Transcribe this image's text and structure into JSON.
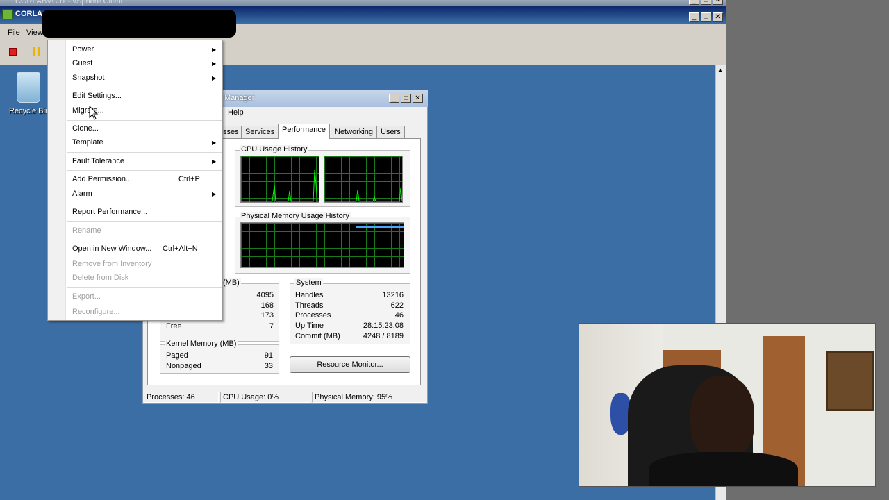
{
  "outer_window": {
    "title": "CORLABVC01 - vSphere Client"
  },
  "console_window": {
    "title": "CORLA",
    "menu": {
      "file": "File",
      "view": "View"
    }
  },
  "desktop": {
    "recycle_bin_label": "Recycle Bin"
  },
  "context_menu": {
    "items": [
      {
        "label": "Power",
        "shortcut": "",
        "submenu": true,
        "disabled": false
      },
      {
        "label": "Guest",
        "shortcut": "",
        "submenu": true,
        "disabled": false
      },
      {
        "label": "Snapshot",
        "shortcut": "",
        "submenu": true,
        "disabled": false
      },
      {
        "label": "Edit Settings...",
        "shortcut": "",
        "submenu": false,
        "disabled": false
      },
      {
        "label": "Migrate...",
        "shortcut": "",
        "submenu": false,
        "disabled": false
      },
      {
        "label": "Clone...",
        "shortcut": "",
        "submenu": false,
        "disabled": false
      },
      {
        "label": "Template",
        "shortcut": "",
        "submenu": true,
        "disabled": false
      },
      {
        "label": "Fault Tolerance",
        "shortcut": "",
        "submenu": true,
        "disabled": false
      },
      {
        "label": "Add Permission...",
        "shortcut": "Ctrl+P",
        "submenu": false,
        "disabled": false
      },
      {
        "label": "Alarm",
        "shortcut": "",
        "submenu": true,
        "disabled": false
      },
      {
        "label": "Report Performance...",
        "shortcut": "",
        "submenu": false,
        "disabled": false
      },
      {
        "label": "Rename",
        "shortcut": "",
        "submenu": false,
        "disabled": true
      },
      {
        "label": "Open in New Window...",
        "shortcut": "Ctrl+Alt+N",
        "submenu": false,
        "disabled": false
      },
      {
        "label": "Remove from Inventory",
        "shortcut": "",
        "submenu": false,
        "disabled": true
      },
      {
        "label": "Delete from Disk",
        "shortcut": "",
        "submenu": false,
        "disabled": true
      },
      {
        "label": "Export...",
        "shortcut": "",
        "submenu": false,
        "disabled": true
      },
      {
        "label": "Reconfigure...",
        "shortcut": "",
        "submenu": false,
        "disabled": true
      }
    ]
  },
  "task_manager": {
    "title": "Manager",
    "menu_help": "Help",
    "tabs": [
      "sses",
      "Services",
      "Performance",
      "Networking",
      "Users"
    ],
    "active_tab": "Performance",
    "cpu_history_label": "CPU Usage History",
    "memory_history_label": "Physical Memory Usage History",
    "physical_memory_group_label": "(MB)",
    "physical_memory": [
      {
        "label": "",
        "value": "4095"
      },
      {
        "label": "",
        "value": "168"
      },
      {
        "label": "",
        "value": "173"
      },
      {
        "label": "Free",
        "value": "7"
      }
    ],
    "system_group_label": "System",
    "system": [
      {
        "label": "Handles",
        "value": "13216"
      },
      {
        "label": "Threads",
        "value": "622"
      },
      {
        "label": "Processes",
        "value": "46"
      },
      {
        "label": "Up Time",
        "value": "28:15:23:08"
      },
      {
        "label": "Commit (MB)",
        "value": "4248 / 8189"
      }
    ],
    "kernel_group_label": "Kernel Memory (MB)",
    "kernel": [
      {
        "label": "Paged",
        "value": "91"
      },
      {
        "label": "Nonpaged",
        "value": "33"
      }
    ],
    "resource_monitor_button": "Resource Monitor...",
    "status": {
      "processes": "Processes: 46",
      "cpu": "CPU Usage: 0%",
      "memory": "Physical Memory: 95%"
    }
  },
  "colors": {
    "desktop": "#3a6ea5",
    "graph_line": "#00ff00",
    "memory_line": "#4aa3ff"
  }
}
